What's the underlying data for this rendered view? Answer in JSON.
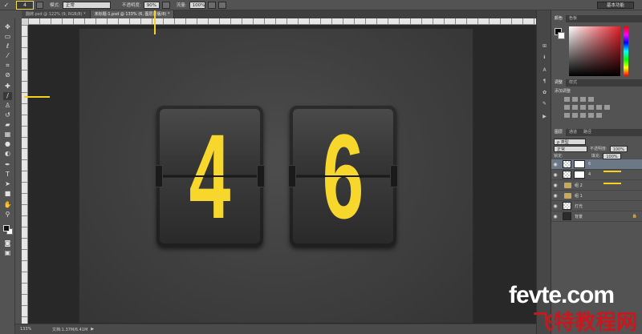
{
  "options_bar": {
    "mode_label": "模式:",
    "mode_value": "正常",
    "opacity_label": "不透明度:",
    "opacity_value": "90%",
    "flow_label": "流量:",
    "flow_value": "100%",
    "workspace": "基本功能",
    "preset_size": "4"
  },
  "tabs": [
    {
      "label": "翻牌.psd @ 122% (9, RGB/8) *"
    },
    {
      "label": "未标题-1.psd @ 133% (6, 图层蒙版/8) *"
    }
  ],
  "canvas": {
    "digits": [
      "4",
      "6"
    ],
    "digit_color": "#f8d72c"
  },
  "status": {
    "zoom": "133%",
    "doc": "文档:1.37M/6.41M"
  },
  "panels": {
    "color_tabs": [
      "颜色",
      "色板"
    ],
    "adj_tabs": [
      "调整",
      "样式"
    ],
    "adj_title": "添加调整",
    "layer_tabs": [
      "图层",
      "通道",
      "路径"
    ],
    "kind_label": "ρ 类型",
    "blend_value": "正常",
    "opacity_label": "不透明度:",
    "opacity_value": "100%",
    "lock_label": "锁定:",
    "fill_label": "填充:",
    "fill_value": "100%",
    "layers": [
      {
        "name": "6",
        "type": "masked",
        "selected": true
      },
      {
        "name": "4",
        "type": "masked",
        "selected": false
      },
      {
        "name": "组 2",
        "type": "group",
        "selected": false
      },
      {
        "name": "组 1",
        "type": "group",
        "selected": false
      },
      {
        "name": "灯光",
        "type": "plain",
        "selected": false
      },
      {
        "name": "背景",
        "type": "background",
        "selected": false
      }
    ]
  },
  "watermark": {
    "line1": "fevte.com",
    "line2": "飞特教程网"
  }
}
